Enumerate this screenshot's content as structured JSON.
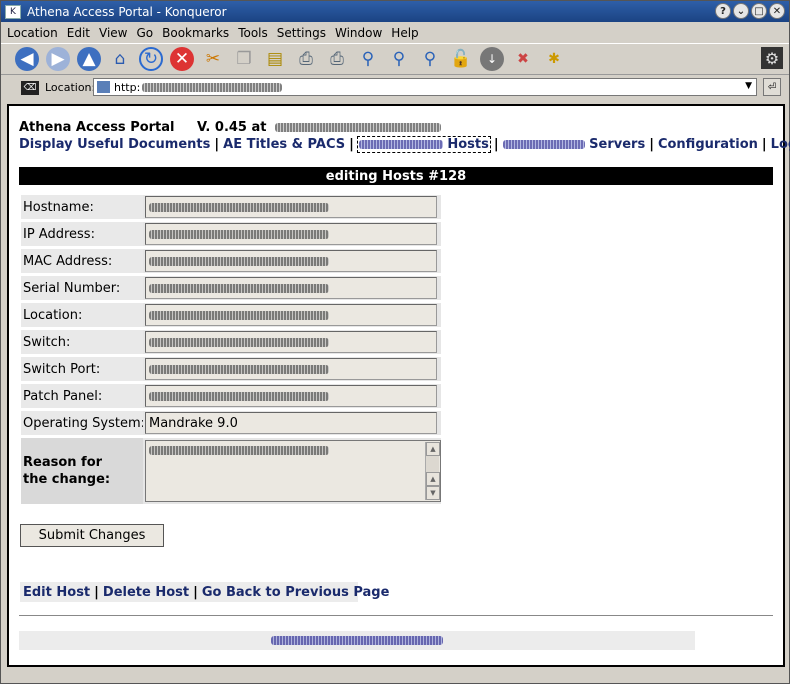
{
  "window": {
    "title": "Athena Access Portal - Konqueror",
    "buttons": [
      "?",
      "⌄",
      "□",
      "✕"
    ]
  },
  "menu": [
    "Location",
    "Edit",
    "View",
    "Go",
    "Bookmarks",
    "Tools",
    "Settings",
    "Window",
    "Help"
  ],
  "toolbar": {
    "icons": [
      "back-icon",
      "forward-icon",
      "up-icon",
      "home-icon",
      "reload-icon",
      "stop-icon",
      "cut-icon",
      "copy-icon",
      "paste-icon",
      "print-icon",
      "print-frame-icon",
      "zoom-icon",
      "zoom-in-icon",
      "zoom-out-icon",
      "lock-icon",
      "download-icon",
      "delete-icon",
      "new-folder-icon"
    ]
  },
  "location": {
    "label": "Location:",
    "url": "http:"
  },
  "page": {
    "app_name": "Athena Access Portal",
    "version": "V. 0.45 at",
    "nav": {
      "display_docs": "Display Useful Documents",
      "ae_titles": "AE Titles & PACS",
      "hosts": "Hosts",
      "servers": "Servers",
      "configuration": "Configuration",
      "logout": "Logout"
    },
    "banner": "editing Hosts #128",
    "fields": {
      "hostname": "Hostname:",
      "ip_address": "IP Address:",
      "mac_address": "MAC Address:",
      "serial_number": "Serial Number:",
      "location": "Location:",
      "switch": "Switch:",
      "switch_port": "Switch Port:",
      "patch_panel": "Patch Panel:",
      "operating_system": "Operating System:",
      "operating_system_value": "Mandrake 9.0",
      "reason_line1": "Reason for",
      "reason_line2": "the change:"
    },
    "submit_label": "Submit Changes",
    "actions": {
      "edit": "Edit Host",
      "delete": "Delete Host",
      "back": "Go Back to Previous Page"
    }
  }
}
